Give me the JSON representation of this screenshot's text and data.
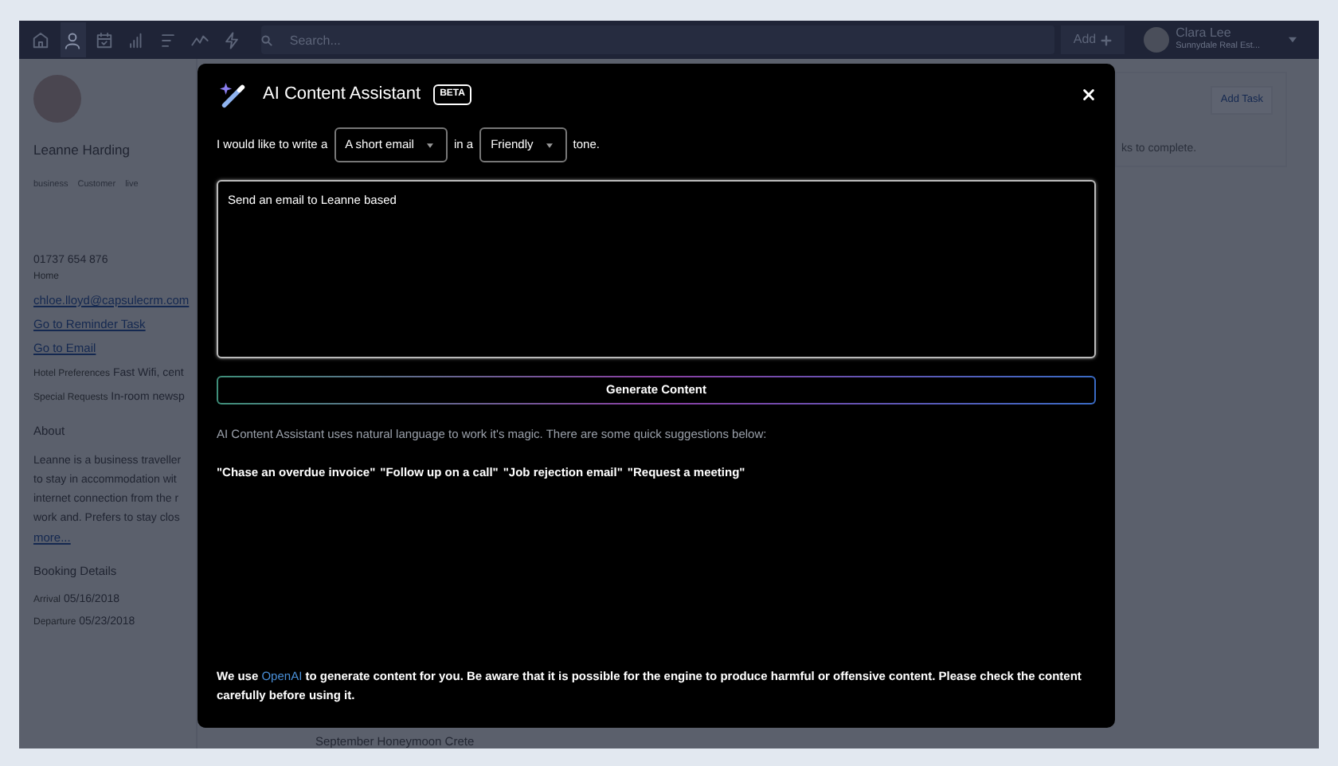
{
  "topbar": {
    "nav": [
      {
        "kind": "home",
        "selected": false
      },
      {
        "kind": "person",
        "selected": true
      },
      {
        "kind": "calendar",
        "selected": false
      },
      {
        "kind": "bars",
        "selected": false
      },
      {
        "kind": "list",
        "selected": false
      },
      {
        "kind": "trend",
        "selected": false
      },
      {
        "kind": "bolt",
        "selected": false
      }
    ],
    "search": {
      "placeholder": "Search..."
    },
    "add_button": "Add",
    "user": {
      "name": "Clara Lee",
      "company": "Sunnydale Real Est..."
    }
  },
  "sidebar": {
    "name": "Leanne Harding",
    "tags": [
      "business",
      "Customer",
      "live"
    ],
    "phone": "01737 654 876",
    "phone_label": "Home",
    "email": "chloe.lloyd@capsulecrm.com",
    "links": [
      "Go to Reminder Task",
      "Go to Email"
    ],
    "details": [
      {
        "label": "Hotel Preferences",
        "value": "Fast Wifi, cent"
      },
      {
        "label": "Special Requests",
        "value": "In-room newsp"
      }
    ],
    "about_heading": "About",
    "about_lines": [
      "Leanne is a business traveller",
      "to stay in accommodation wit",
      "internet connection from the r",
      "work and. Prefers to stay clos"
    ],
    "about_more": "more...",
    "booking_heading": "Booking Details",
    "booking": [
      {
        "label": "Arrival",
        "value": "05/16/2018"
      },
      {
        "label": "Departure",
        "value": "05/23/2018"
      }
    ]
  },
  "tasks_panel": {
    "add_button": "Add Task",
    "text": "ks to complete."
  },
  "bottom_row": "September Honeymoon Crete",
  "modal": {
    "title": "AI Content Assistant",
    "badge": "BETA",
    "sentence": [
      {
        "kind": "text",
        "text": "I would like to write a"
      },
      {
        "kind": "select",
        "value": "A short email"
      },
      {
        "kind": "text",
        "text": "in a"
      },
      {
        "kind": "select",
        "value": "Friendly"
      },
      {
        "kind": "text",
        "text": "tone."
      }
    ],
    "prompt": "Send an email to Leanne based ",
    "generate_button": "Generate Content",
    "info": "AI Content Assistant uses natural language to work it's magic. There are some quick suggestions below:",
    "suggestions": [
      "\"Chase an overdue invoice\"",
      "\"Follow up on a call\"",
      "\"Job rejection email\"",
      "\"Request a meeting\""
    ],
    "footer": {
      "before": "We use ",
      "link": "OpenAI",
      "after": " to generate content for you. Be aware that it is possible for the engine to produce harmful or offensive content. Please check the content carefully before using it."
    }
  }
}
